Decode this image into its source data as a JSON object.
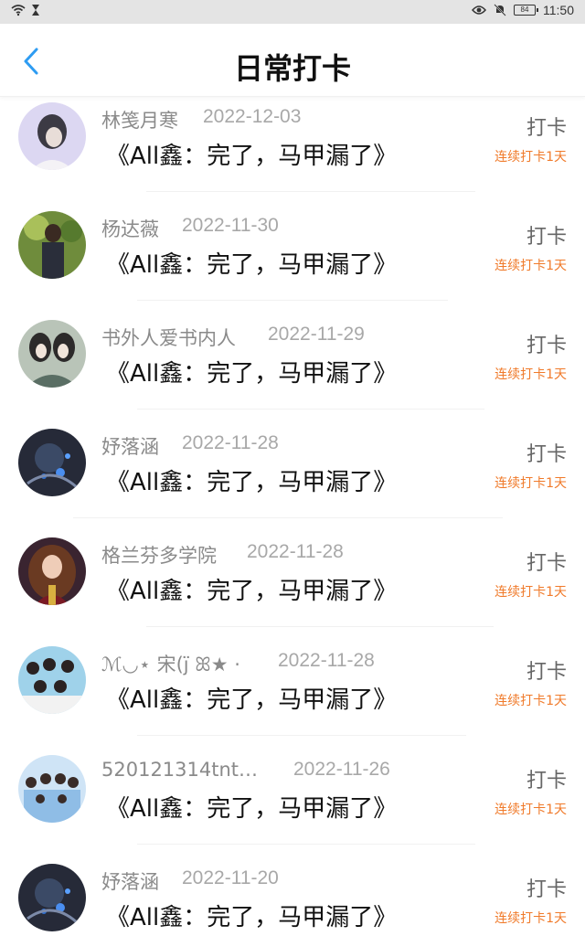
{
  "status_bar": {
    "time": "11:50",
    "battery": "84",
    "icons": [
      "wifi-icon",
      "hourglass-icon",
      "eye-icon",
      "mute-bell-icon",
      "battery-icon"
    ]
  },
  "header": {
    "title": "日常打卡",
    "back_icon": "chevron-left-icon"
  },
  "colors": {
    "accent": "#2e9cf2",
    "streak": "#f07a2a",
    "muted_text": "#8a8a8a"
  },
  "records": [
    {
      "name": "林笺月寒",
      "date": "2022-12-03",
      "book": "《All鑫：完了，马甲漏了》",
      "checkin": "打卡",
      "streak": "连续打卡1天"
    },
    {
      "name": "杨达薇",
      "date": "2022-11-30",
      "book": "《All鑫：完了，马甲漏了》",
      "checkin": "打卡",
      "streak": "连续打卡1天"
    },
    {
      "name": "书外人爱书内人",
      "date": "2022-11-29",
      "book": "《All鑫：完了，马甲漏了》",
      "checkin": "打卡",
      "streak": "连续打卡1天"
    },
    {
      "name": "妤落涵",
      "date": "2022-11-28",
      "book": "《All鑫：完了，马甲漏了》",
      "checkin": "打卡",
      "streak": "连续打卡1天"
    },
    {
      "name": "格兰芬多学院",
      "date": "2022-11-28",
      "book": "《All鑫：完了，马甲漏了》",
      "checkin": "打卡",
      "streak": "连续打卡1天"
    },
    {
      "name": "ℳ◡⋆ 宋(j̈ ꕤ★ ·",
      "date": "2022-11-28",
      "book": "《All鑫：完了，马甲漏了》",
      "checkin": "打卡",
      "streak": "连续打卡1天"
    },
    {
      "name": "520121314tnt…",
      "date": "2022-11-26",
      "book": "《All鑫：完了，马甲漏了》",
      "checkin": "打卡",
      "streak": "连续打卡1天"
    },
    {
      "name": "妤落涵",
      "date": "2022-11-20",
      "book": "《All鑫：完了，马甲漏了》",
      "checkin": "打卡",
      "streak": "连续打卡1天"
    }
  ]
}
